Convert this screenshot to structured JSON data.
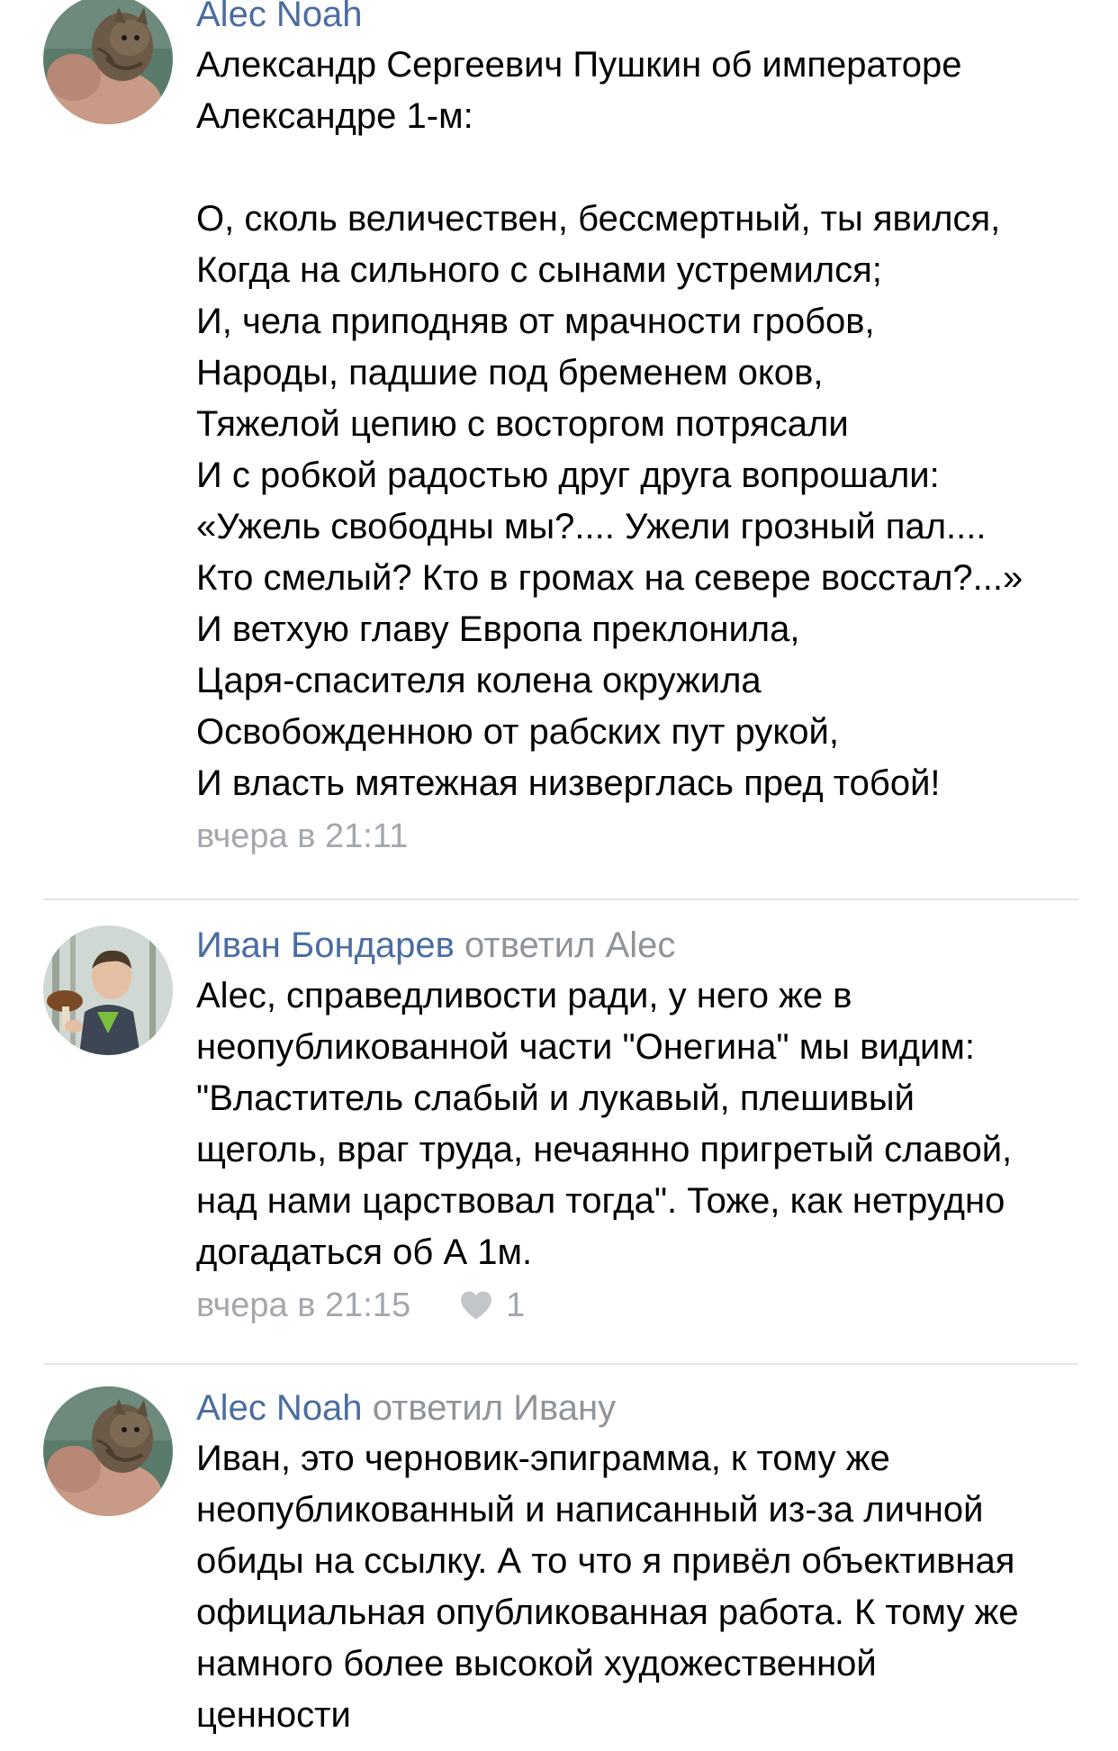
{
  "comments": [
    {
      "author": "Alec Noah",
      "reply_to": "",
      "avatar_icon": "cat-avatar",
      "text": "Александр Сергеевич Пушкин об императоре\nАлександре 1-м:\n\nО, сколь величествен, бессмертный, ты явился,\nКогда на сильного с сынами устремился;\nИ, чела приподняв от мрачности гробов,\nНароды, падшие под бременем оков,\nТяжелой цепию с восторгом потрясали\nИ с робкой радостью друг друга вопрошали:\n«Ужель свободны мы?.... Ужели грозный пал....\nКто смелый? Кто в громах на севере восстал?...»\nИ ветхую главу Европа преклонила,\nЦаря-спасителя колена окружила\nОсвобожденною от рабских пут рукой,\nИ власть мятежная низверглась пред тобой!",
      "time": "вчера в 21:11",
      "likes": ""
    },
    {
      "author": "Иван Бондарев",
      "reply_to": "ответил Alec",
      "avatar_icon": "man-with-mushroom-avatar",
      "text": "Alec, справедливости ради, у него же в\nнеопубликованной части \"Онегина\" мы видим:\n\"Властитель слабый и лукавый, плешивый\nщеголь, враг труда, нечаянно пригретый славой,\nнад нами царствовал тогда\". Тоже, как нетрудно\nдогадаться об А 1м.",
      "time": "вчера в 21:15",
      "likes": "1"
    },
    {
      "author": "Alec Noah",
      "reply_to": "ответил Ивану",
      "avatar_icon": "cat-avatar",
      "text": "Иван, это черновик-эпиграмма, к тому же\nнеопубликованный и написанный из-за личной\nобиды на ссылку. А то что я привёл объективная\nофициальная опубликованная работа. К тому же\nнамного более высокой художественной\nценности",
      "time": "",
      "likes": ""
    }
  ],
  "icons": {
    "like": "heart-icon"
  },
  "colors": {
    "author": "#4a6da1",
    "secondary": "#8e949a",
    "meta": "#a3a8ae",
    "divider": "#e3e5e8"
  }
}
